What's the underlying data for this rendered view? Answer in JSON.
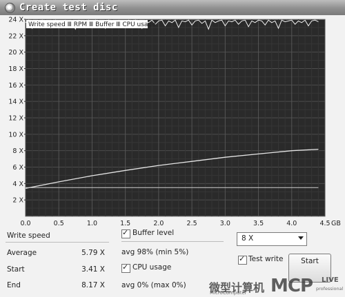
{
  "window": {
    "title": "Create test disc",
    "app_icon": "disc-icon"
  },
  "chart_data": {
    "type": "line",
    "legend": [
      "Write speed",
      "RPM",
      "Buffer",
      "CPU usage"
    ],
    "legend_placement": "top-left",
    "xlabel_unit": "GB",
    "xlim": [
      0,
      4.5
    ],
    "ylim": [
      0,
      24
    ],
    "x_ticks": [
      "0.0",
      "0.5",
      "1.0",
      "1.5",
      "2.0",
      "2.5",
      "3.0",
      "3.5",
      "4.0",
      "4.5"
    ],
    "y_ticks": [
      "2 X",
      "4 X",
      "6 X",
      "8 X",
      "10 X",
      "12 X",
      "14 X",
      "16 X",
      "18 X",
      "20 X",
      "22 X",
      "24 X"
    ],
    "grid": true,
    "series": [
      {
        "name": "Write speed",
        "color": "#e6e6e6",
        "x": [
          0,
          0.5,
          1.0,
          1.5,
          2.0,
          2.5,
          3.0,
          3.5,
          4.0,
          4.4
        ],
        "y": [
          3.41,
          4.2,
          4.95,
          5.6,
          6.2,
          6.7,
          7.2,
          7.6,
          8.0,
          8.17
        ]
      },
      {
        "name": "RPM",
        "color": "#cfcfcf",
        "x": [
          0,
          4.4
        ],
        "y": [
          3.5,
          3.5
        ]
      },
      {
        "name": "Buffer",
        "color": "#f0f0f0",
        "x": [
          0,
          0.05,
          0.1,
          0.15,
          0.2,
          0.25,
          0.3,
          0.35,
          0.4,
          0.45,
          0.5,
          0.55,
          0.6,
          0.65,
          0.7,
          0.75,
          0.8,
          0.85,
          0.9,
          0.95,
          1.0,
          1.05,
          1.1,
          1.15,
          1.2,
          1.25,
          1.3,
          1.35,
          1.4,
          1.45,
          1.5,
          1.55,
          1.6,
          1.65,
          1.7,
          1.75,
          1.8,
          1.85,
          1.9,
          1.95,
          2.0,
          2.05,
          2.1,
          2.15,
          2.2,
          2.25,
          2.3,
          2.35,
          2.4,
          2.45,
          2.5,
          2.55,
          2.6,
          2.65,
          2.7,
          2.75,
          2.8,
          2.85,
          2.9,
          2.95,
          3.0,
          3.05,
          3.1,
          3.15,
          3.2,
          3.25,
          3.3,
          3.35,
          3.4,
          3.45,
          3.5,
          3.55,
          3.6,
          3.65,
          3.7,
          3.75,
          3.8,
          3.85,
          3.9,
          3.95,
          4.0,
          4.05,
          4.1,
          4.15,
          4.2,
          4.25,
          4.3,
          4.35,
          4.4
        ],
        "y": [
          23.6,
          23.9,
          22.9,
          23.8,
          23.5,
          23.9,
          23.0,
          23.8,
          23.6,
          23.9,
          23.2,
          23.8,
          23.9,
          23.4,
          23.8,
          22.8,
          23.9,
          23.5,
          23.8,
          23.9,
          23.3,
          23.9,
          23.6,
          23.8,
          22.9,
          23.9,
          23.7,
          23.4,
          23.9,
          23.8,
          23.1,
          23.9,
          23.6,
          23.9,
          23.8,
          22.9,
          23.8,
          23.6,
          23.9,
          23.4,
          23.8,
          23.9,
          23.2,
          23.8,
          23.6,
          23.9,
          23.0,
          23.8,
          23.7,
          23.9,
          23.3,
          23.8,
          23.9,
          23.5,
          23.8,
          22.8,
          23.9,
          23.6,
          23.8,
          23.9,
          23.2,
          23.8,
          23.7,
          23.9,
          23.4,
          23.8,
          23.9,
          23.1,
          23.8,
          23.6,
          23.9,
          23.8,
          23.3,
          23.9,
          23.6,
          23.8,
          22.9,
          23.9,
          23.7,
          23.8,
          23.9,
          23.4,
          23.8,
          23.6,
          23.9,
          23.2,
          23.8,
          23.9,
          23.7
        ]
      },
      {
        "name": "CPU usage",
        "color": "#888888",
        "x": [
          0,
          4.4
        ],
        "y": [
          0,
          0
        ]
      }
    ]
  },
  "write_speed": {
    "title": "Write speed",
    "rows": [
      {
        "label": "Average",
        "value": "5.79 X"
      },
      {
        "label": "Start",
        "value": "3.41 X"
      },
      {
        "label": "End",
        "value": "8.17 X"
      }
    ]
  },
  "buffer": {
    "label": "Buffer level",
    "checked": true,
    "stats": "avg 98% (min 5%)"
  },
  "cpu": {
    "label": "CPU usage",
    "checked": true,
    "stats": "avg 0% (max 0%)"
  },
  "speed_select": {
    "value": "8 X"
  },
  "test_write": {
    "label": "Test write",
    "checked": true
  },
  "start_button": {
    "label": "Start"
  },
  "watermark": {
    "cn": "微型计算机",
    "en": "MicroComputer",
    "logo": "MCP",
    "live": "LIVE",
    "prof": "professional"
  }
}
